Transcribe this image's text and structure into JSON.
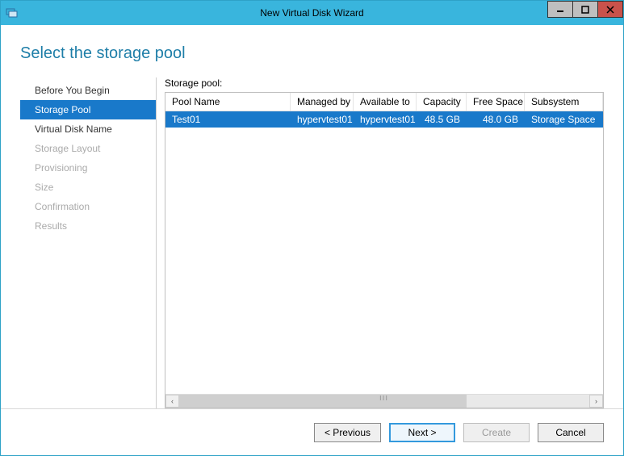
{
  "window": {
    "title": "New Virtual Disk Wizard"
  },
  "page_title": "Select the storage pool",
  "steps": [
    {
      "label": "Before You Begin",
      "state": "done"
    },
    {
      "label": "Storage Pool",
      "state": "active"
    },
    {
      "label": "Virtual Disk Name",
      "state": "done"
    },
    {
      "label": "Storage Layout",
      "state": "disabled"
    },
    {
      "label": "Provisioning",
      "state": "disabled"
    },
    {
      "label": "Size",
      "state": "disabled"
    },
    {
      "label": "Confirmation",
      "state": "disabled"
    },
    {
      "label": "Results",
      "state": "disabled"
    }
  ],
  "main": {
    "label": "Storage pool:",
    "columns": {
      "name": "Pool Name",
      "managed": "Managed by",
      "available": "Available to",
      "capacity": "Capacity",
      "free": "Free Space",
      "subsystem": "Subsystem"
    },
    "rows": [
      {
        "name": "Test01",
        "managed": "hypervtest01",
        "available": "hypervtest01",
        "capacity": "48.5 GB",
        "free": "48.0 GB",
        "subsystem": "Storage Space"
      }
    ]
  },
  "buttons": {
    "previous": "< Previous",
    "next": "Next >",
    "create": "Create",
    "cancel": "Cancel"
  },
  "scroll": {
    "left": "‹",
    "right": "›",
    "thumb": "▮▮▮"
  }
}
